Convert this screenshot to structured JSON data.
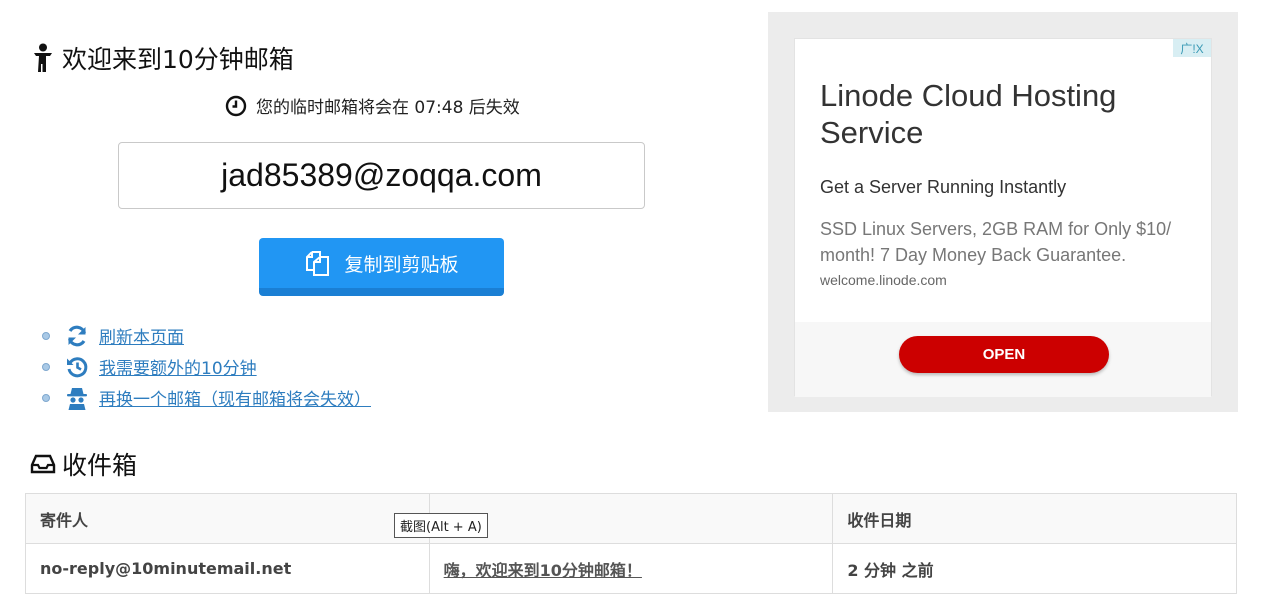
{
  "header": {
    "title": "欢迎来到10分钟邮箱",
    "title_icon": "person-icon"
  },
  "timer": {
    "text": "您的临时邮箱将会在 07:48 后失效",
    "icon": "clock-icon"
  },
  "email": {
    "address": "jad85389@zoqqa.com"
  },
  "copy_button": {
    "label": "复制到剪贴板",
    "icon": "copy-icon",
    "color": "#2196f3"
  },
  "actions": [
    {
      "label": "刷新本页面",
      "icon": "refresh-icon"
    },
    {
      "label": "我需要额外的10分钟",
      "icon": "history-icon"
    },
    {
      "label": "再换一个邮箱（现有邮箱将会失效）",
      "icon": "incognito-icon"
    }
  ],
  "inbox": {
    "title": "收件箱",
    "title_icon": "inbox-icon",
    "columns": [
      "寄件人",
      "",
      "收件日期"
    ],
    "rows": [
      {
        "sender": "no-reply@10minutemail.net",
        "subject": "嗨，欢迎来到10分钟邮箱！",
        "date": "2 分钟 之前"
      }
    ]
  },
  "tooltip": {
    "text": "截图(Alt + A)"
  },
  "ad": {
    "badge": "广!X",
    "title": "Linode Cloud Hosting Service",
    "subtitle": "Get a Server Running Instantly",
    "description": "SSD Linux Servers, 2GB RAM for Only $10/ month! 7 Day Money Back Guarantee.",
    "url": "welcome.linode.com",
    "button": "OPEN",
    "button_color": "#cc0000"
  }
}
